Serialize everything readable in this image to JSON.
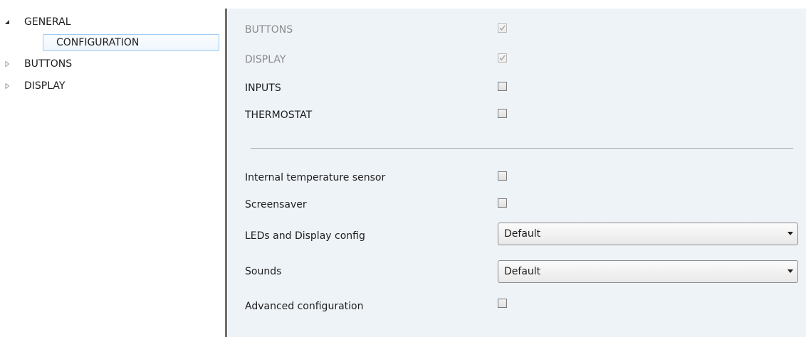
{
  "tree": {
    "nodes": [
      {
        "label": "GENERAL",
        "expanded": true
      },
      {
        "label": "CONFIGURATION",
        "selected": true
      },
      {
        "label": "BUTTONS",
        "expanded": false
      },
      {
        "label": "DISPLAY",
        "expanded": false
      }
    ]
  },
  "settings": {
    "modules": [
      {
        "label": "BUTTONS",
        "checked": true,
        "enabled": false
      },
      {
        "label": "DISPLAY",
        "checked": true,
        "enabled": false
      },
      {
        "label": "INPUTS",
        "checked": false,
        "enabled": true
      },
      {
        "label": "THERMOSTAT",
        "checked": false,
        "enabled": true
      }
    ],
    "internal_temp_sensor": {
      "label": "Internal temperature sensor",
      "checked": false
    },
    "screensaver": {
      "label": "Screensaver",
      "checked": false
    },
    "leds_display": {
      "label": "LEDs and Display config",
      "value": "Default"
    },
    "sounds": {
      "label": "Sounds",
      "value": "Default"
    },
    "advanced": {
      "label": "Advanced configuration",
      "checked": false
    }
  },
  "colors": {
    "panel_background": "#eef3f8",
    "selection_border": "#9ecbef",
    "splitter": "#6f6f6f",
    "disabled_text": "#8a8a8a"
  },
  "icons": {
    "expanded": "expanded-triangle-icon",
    "collapsed": "collapsed-triangle-icon",
    "check": "checkmark-icon",
    "dropdown": "dropdown-arrow-icon"
  }
}
